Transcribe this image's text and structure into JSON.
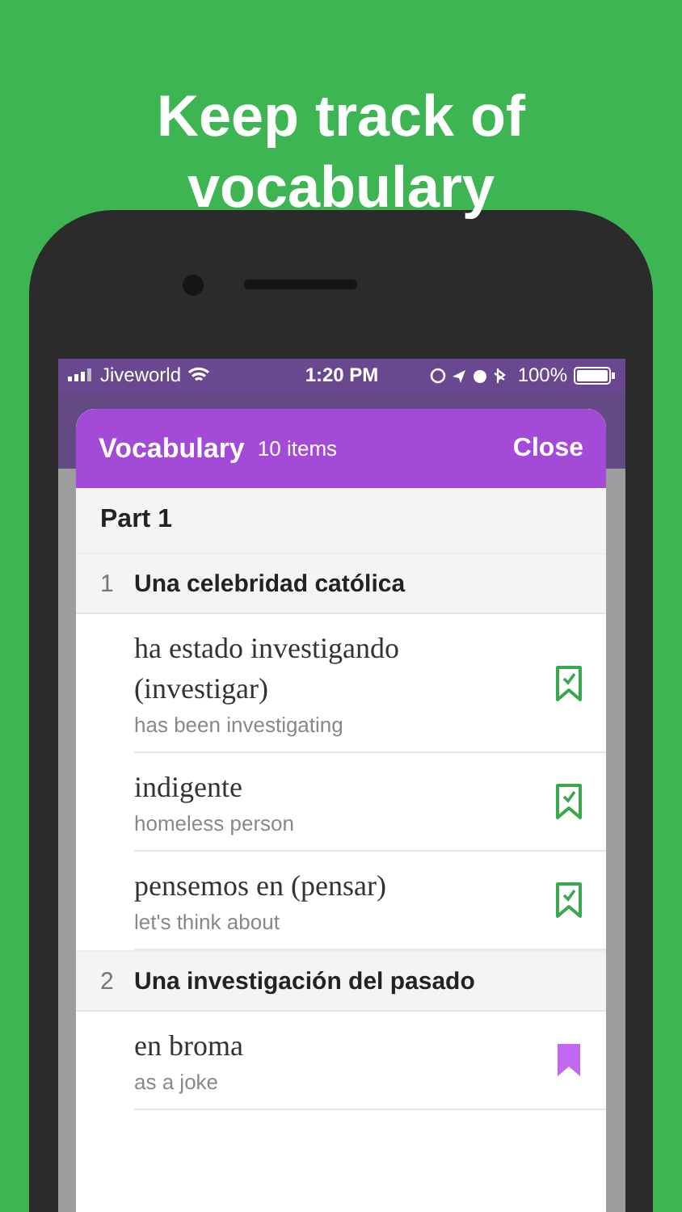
{
  "headline": [
    "Keep track of",
    "vocabulary"
  ],
  "status_bar": {
    "carrier": "Jiveworld",
    "time": "1:20 PM",
    "battery": "100%"
  },
  "modal": {
    "title": "Vocabulary",
    "count": "10 items",
    "close": "Close"
  },
  "part": "Part 1",
  "sections": [
    {
      "number": "1",
      "title": "Una celebridad católica",
      "entries": [
        {
          "word": "ha estado investigando (investigar)",
          "gloss": "has been investigating",
          "learned": true
        },
        {
          "word": "indigente",
          "gloss": "homeless person",
          "learned": true
        },
        {
          "word": "pensemos en (pensar)",
          "gloss": "let's think about",
          "learned": true
        }
      ]
    },
    {
      "number": "2",
      "title": "Una investigación del pasado",
      "entries": [
        {
          "word": "en broma",
          "gloss": "as a joke",
          "learned": false
        }
      ]
    }
  ]
}
